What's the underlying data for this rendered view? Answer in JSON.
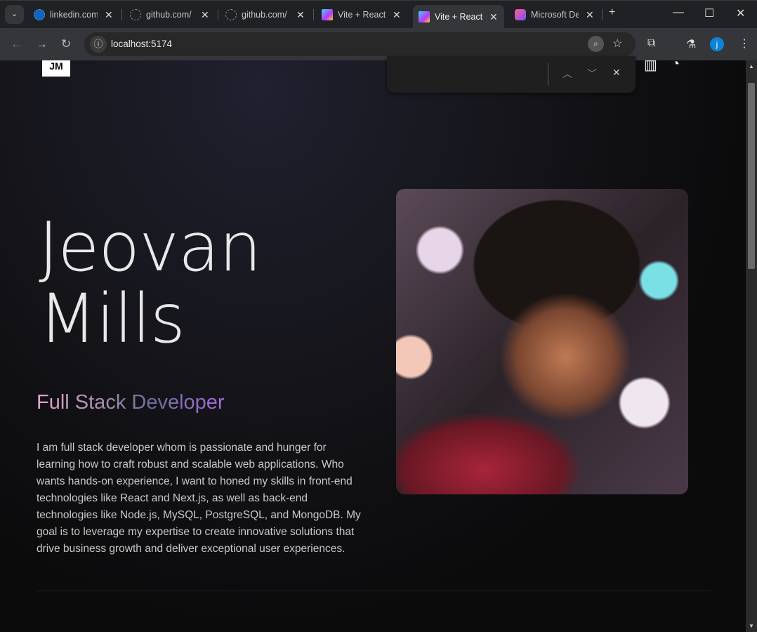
{
  "browser": {
    "tabs": [
      {
        "title": "linkedin.com",
        "icon": "linkedin-icon"
      },
      {
        "title": "github.com/",
        "icon": "github-loading-icon"
      },
      {
        "title": "github.com/",
        "icon": "github-loading-icon"
      },
      {
        "title": "Vite + React",
        "icon": "vite-icon"
      },
      {
        "title": "Vite + React",
        "icon": "vite-icon",
        "active": true
      },
      {
        "title": "Microsoft De",
        "icon": "copilot-icon"
      }
    ],
    "url": "localhost:5174",
    "profile_initial": "j",
    "colors": {
      "avatar": "#0b84d8"
    }
  },
  "header": {
    "logo": "JM",
    "social": [
      "linkedin-icon",
      "github-icon"
    ]
  },
  "hero": {
    "name_line1": "Jeovan",
    "name_line2": "Mills",
    "role": "Full Stack Developer",
    "bio": "I am full stack developer whom is passionate and hunger for learning how to craft robust and scalable web applications. Who wants hands-on experience, I want to honed my skills in front-end technologies like React and Next.js, as well as back-end technologies like Node.js, MySQL, PostgreSQL, and MongoDB. My goal is to leverage my expertise to create innovative solutions that drive business growth and deliver exceptional user experiences.",
    "role_gradient": [
      "#e8a3cc",
      "#6d6f9a",
      "#a56be0"
    ]
  }
}
